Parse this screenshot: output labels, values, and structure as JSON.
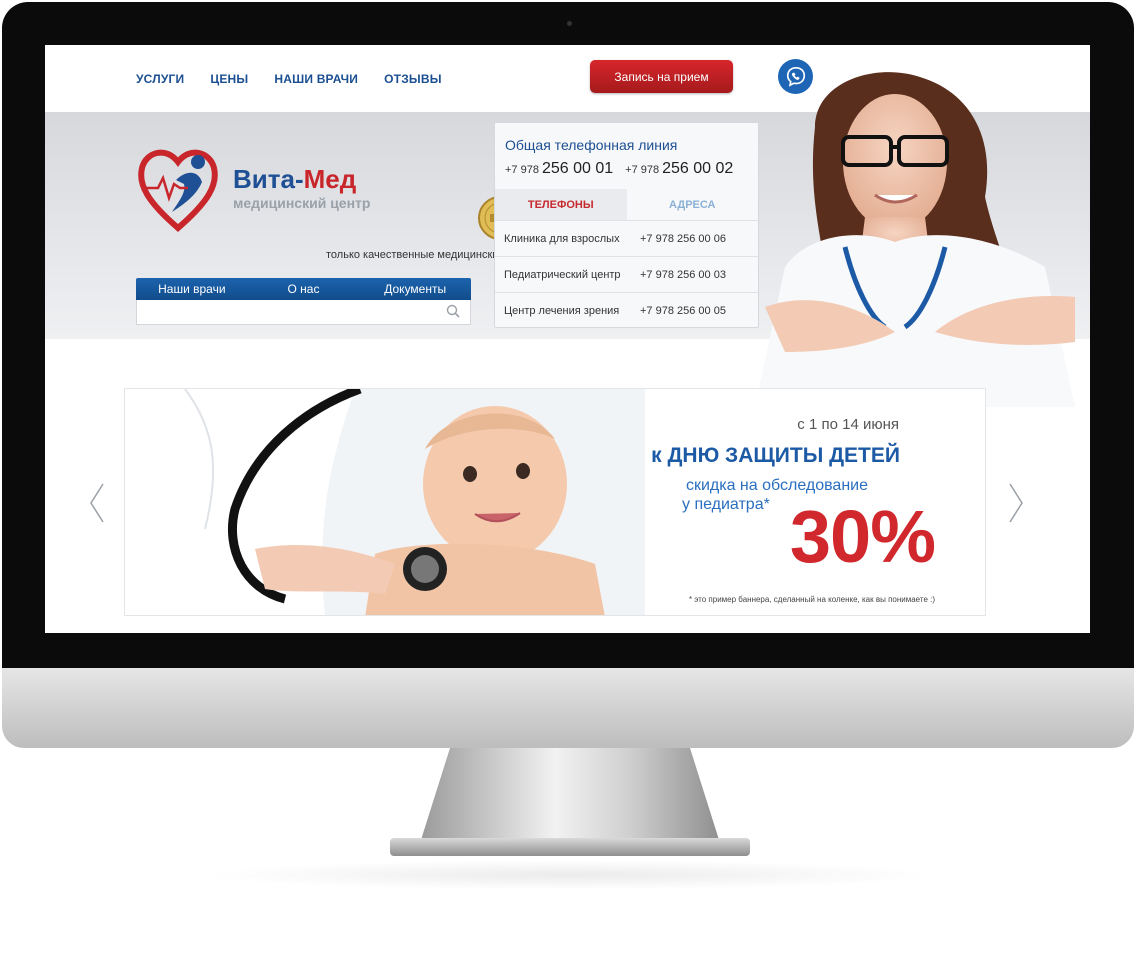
{
  "nav": {
    "items": [
      "УСЛУГИ",
      "ЦЕНЫ",
      "НАШИ ВРАЧИ",
      "ОТЗЫВЫ"
    ],
    "appointment_label": "Запись на прием",
    "viber_icon": "phone-chat-icon"
  },
  "brand": {
    "name_part1": "Вита-",
    "name_part2": "Мед",
    "subtitle": "медицинский центр",
    "tagline": "только качественные медицинские услуги",
    "colors": {
      "blue": "#1f4f95",
      "red": "#c8262b"
    }
  },
  "subnav": {
    "items": [
      "Наши врачи",
      "О нас",
      "Документы"
    ],
    "search_placeholder": ""
  },
  "phones": {
    "title": "Общая телефонная линия",
    "numbers": [
      {
        "prefix": "+7 978",
        "main": "256 00 01"
      },
      {
        "prefix": "+7 978",
        "main": "256 00 02"
      }
    ],
    "tabs": [
      {
        "label": "ТЕЛЕФОНЫ",
        "active": true
      },
      {
        "label": "АДРЕСА",
        "active": false
      }
    ],
    "rows": [
      {
        "name": "Клиника для взрослых",
        "phone": "+7 978 256 00 06"
      },
      {
        "name": "Педиатрический центр",
        "phone": "+7 978 256 00 03"
      },
      {
        "name": "Центр лечения зрения",
        "phone": "+7 978 256 00 05"
      }
    ]
  },
  "banner": {
    "date": "с 1 по 14 июня",
    "headline": "к ДНЮ ЗАЩИТЫ ДЕТЕЙ",
    "line1": "скидка на обследование",
    "line2": "у педиатра*",
    "percent": "30%",
    "footnote": "* это пример баннера, сделанный на коленке, как вы понимаете :)"
  }
}
